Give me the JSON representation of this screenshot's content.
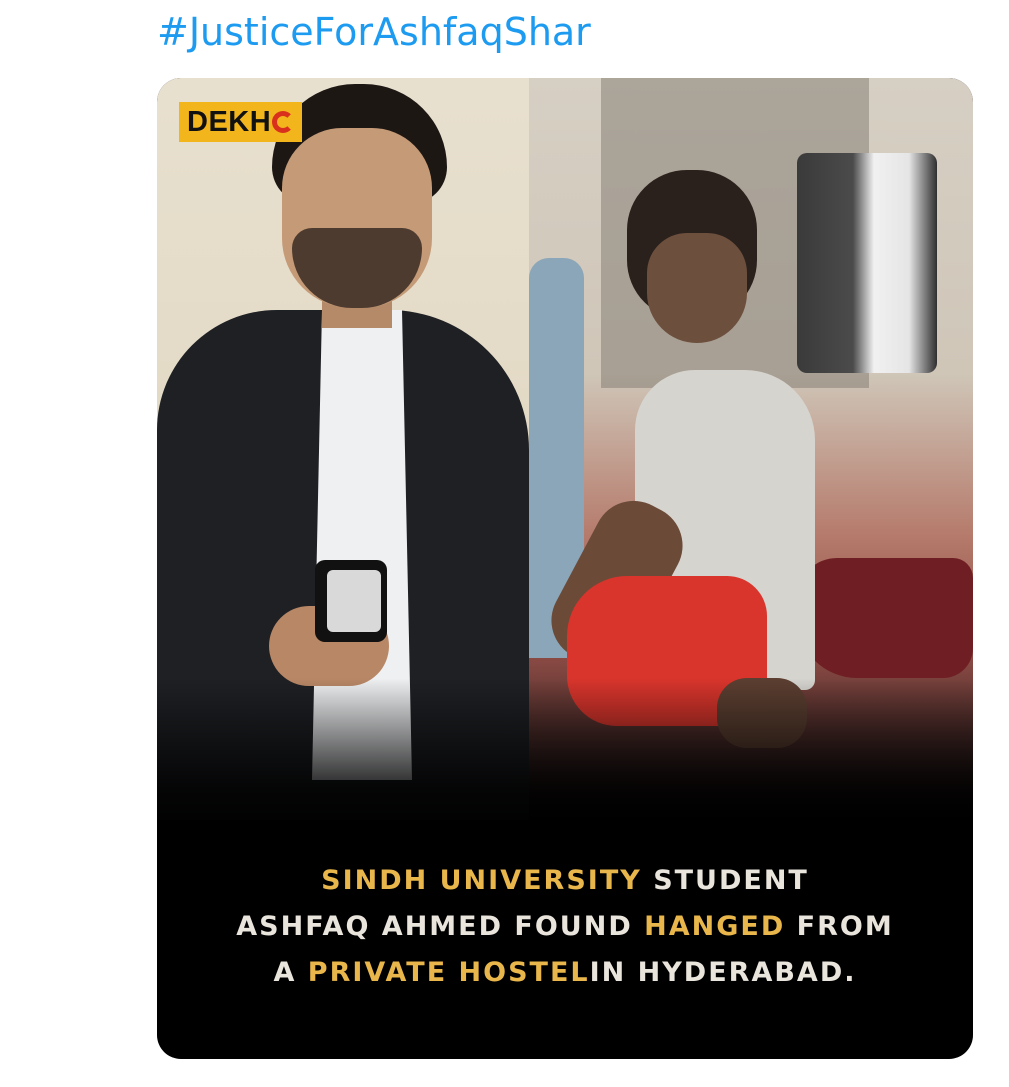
{
  "tweet": {
    "hashtag": "#JusticeForAshfaqShar",
    "link_color": "#1d9bf0"
  },
  "media": {
    "logo": {
      "text": "DEKH",
      "icon": "dekho-o-mark-icon",
      "bg_color": "#f2b51c",
      "mark_color": "#d9301e"
    },
    "caption": {
      "line1": [
        {
          "text": "Sindh University",
          "color": "gold"
        },
        {
          "text": " student",
          "color": "white"
        }
      ],
      "line2": [
        {
          "text": "Ashfaq Ahmed found ",
          "color": "white"
        },
        {
          "text": "hanged",
          "color": "gold"
        },
        {
          "text": " from",
          "color": "white"
        }
      ],
      "line3": [
        {
          "text": "a ",
          "color": "white"
        },
        {
          "text": "private hostel",
          "color": "gold"
        },
        {
          "text": "in Hyderabad.",
          "color": "white"
        }
      ],
      "gold_color": "#e8b64a",
      "white_color": "#e9e4dc"
    }
  }
}
